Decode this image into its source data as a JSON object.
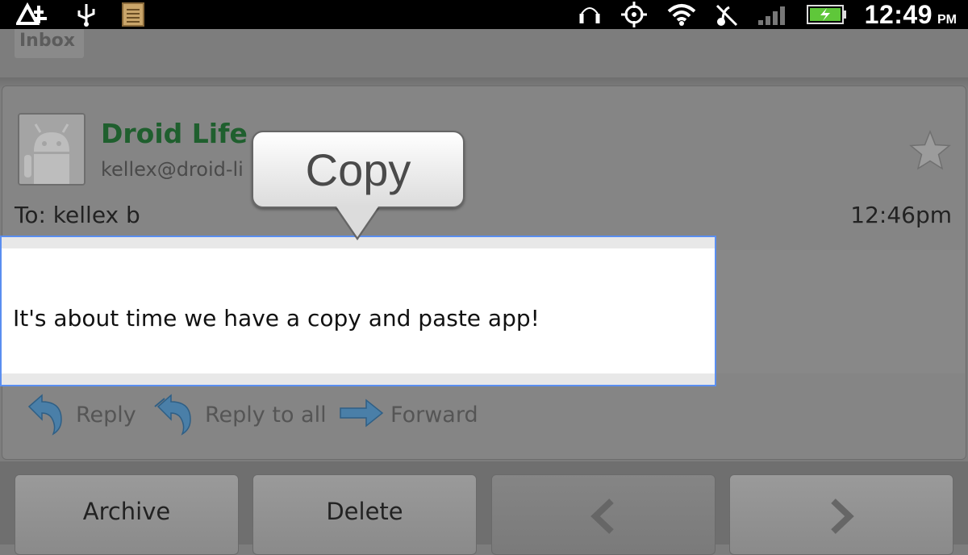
{
  "status_bar": {
    "time": "12:49",
    "ampm": "PM",
    "icons": [
      "signal-notification-icon",
      "usb-icon",
      "notes-icon",
      "headphones-icon",
      "gps-icon",
      "wifi-icon",
      "ringer-off-icon",
      "cell-signal-icon",
      "battery-charging-icon"
    ],
    "battery_color": "#5fc73a"
  },
  "header": {
    "inbox_label": "Inbox"
  },
  "message": {
    "sender_name": "Droid Life",
    "sender_email": "kellex@droid-li",
    "to": "To: kellex b",
    "time": "12:46pm",
    "body": "It's about time we have a copy and paste app!",
    "sender_color": "#1f5f2e"
  },
  "popup": {
    "copy_label": "Copy"
  },
  "actions": {
    "reply": "Reply",
    "reply_all": "Reply to all",
    "forward": "Forward"
  },
  "buttons": {
    "archive": "Archive",
    "delete": "Delete"
  },
  "colors": {
    "selection_border": "#5a8ef0",
    "action_arrow": "#4a7fa8"
  }
}
